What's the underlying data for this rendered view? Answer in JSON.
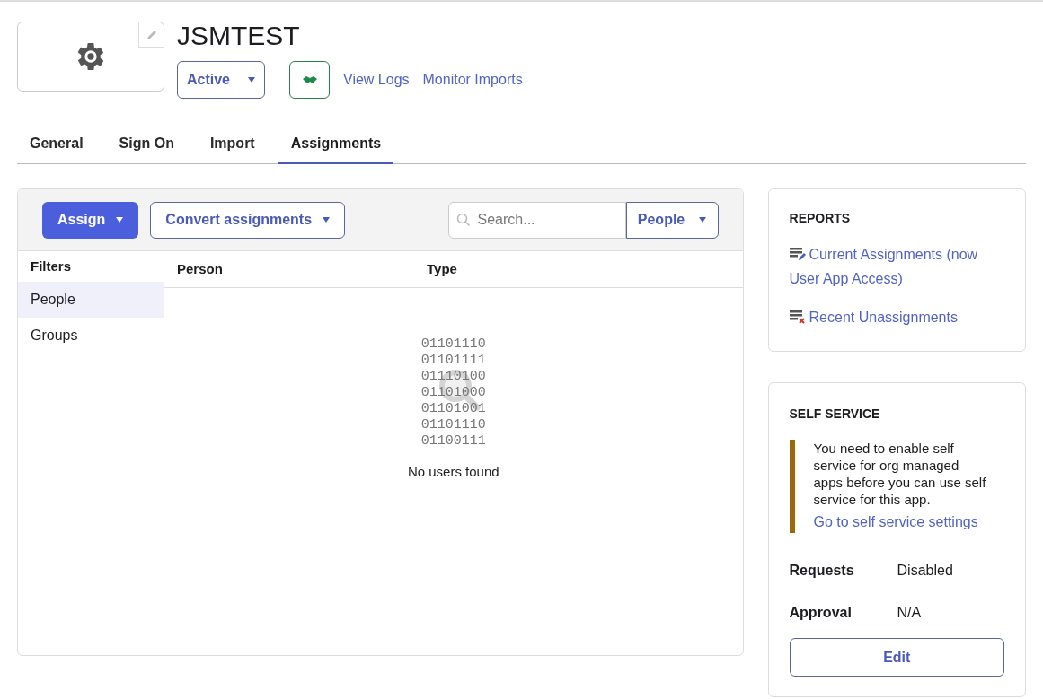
{
  "app": {
    "title": "JSMTEST",
    "status": "Active",
    "links": [
      "View Logs",
      "Monitor Imports"
    ]
  },
  "tabs": [
    {
      "label": "General",
      "selected": false
    },
    {
      "label": "Sign On",
      "selected": false
    },
    {
      "label": "Import",
      "selected": false
    },
    {
      "label": "Assignments",
      "selected": true
    }
  ],
  "toolbar": {
    "assign": "Assign",
    "convert": "Convert assignments",
    "search": {
      "placeholder": "Search..."
    },
    "scope": "People"
  },
  "filters": {
    "title": "Filters",
    "items": [
      {
        "label": "People",
        "selected": true
      },
      {
        "label": "Groups",
        "selected": false
      }
    ]
  },
  "table": {
    "columns": [
      "Person",
      "Type"
    ],
    "empty": {
      "binary": [
        "01101110",
        "01101111",
        "01110100",
        "01101000",
        "01101001",
        "01101110",
        "01100111"
      ],
      "message": "No users found"
    }
  },
  "reports": {
    "title": "REPORTS",
    "links": [
      {
        "kind": "current",
        "label": "Current Assignments (now User App Access)"
      },
      {
        "kind": "removed",
        "label": "Recent Unassignments"
      }
    ]
  },
  "self_service": {
    "title": "SELF SERVICE",
    "notice": "You need to enable self service for org managed apps before you can use self service for this app.",
    "notice_link": "Go to self service settings",
    "fields": [
      {
        "label": "Requests",
        "value": "Disabled"
      },
      {
        "label": "Approval",
        "value": "N/A"
      }
    ],
    "button": "Edit"
  }
}
